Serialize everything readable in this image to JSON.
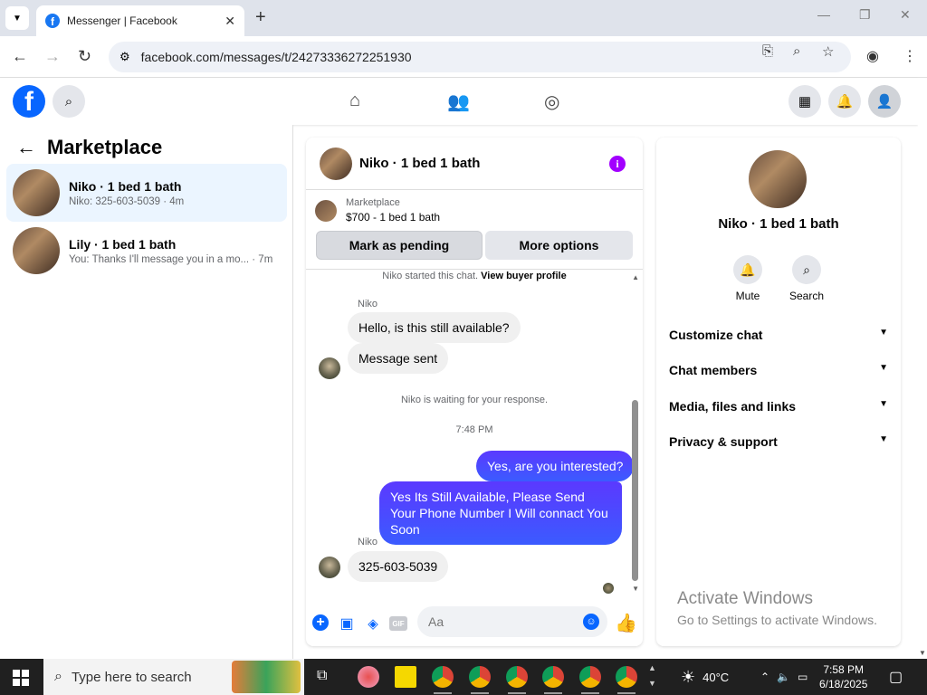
{
  "browser": {
    "tab_title": "Messenger | Facebook",
    "url": "facebook.com/messages/t/24273336272251930"
  },
  "sidebar": {
    "title": "Marketplace",
    "conversations": [
      {
        "name": "Niko · 1 bed 1 bath",
        "snippet": "Niko: 325-603-5039 · 4m",
        "active": true
      },
      {
        "name": "Lily · 1 bed 1 bath",
        "snippet": "You: Thanks I'll message you in a mo... · 7m",
        "active": false
      }
    ]
  },
  "chat": {
    "header_name": "Niko · 1 bed 1 bath",
    "listing_category": "Marketplace",
    "listing_price": "$700 - 1 bed 1 bath",
    "btn_pending": "Mark as pending",
    "btn_more": "More options",
    "started_text": "Niko started this chat.",
    "view_profile": "View buyer profile",
    "sender1": "Niko",
    "msg1": "Hello, is this still available?",
    "msg2": "Message sent",
    "waiting": "Niko is waiting for your response.",
    "time": "7:48 PM",
    "out1": "Yes, are you interested?",
    "out2": "Yes Its Still Available, Please Send Your Phone Number I Will connact You Soon",
    "sender2": "Niko",
    "msg3": "325-603-5039",
    "input_placeholder": "Aa",
    "gif_label": "GIF"
  },
  "details": {
    "name": "Niko · 1 bed 1 bath",
    "mute": "Mute",
    "search": "Search",
    "sections": [
      "Customize chat",
      "Chat members",
      "Media, files and links",
      "Privacy & support"
    ]
  },
  "watermark": {
    "line1": "Activate Windows",
    "line2": "Go to Settings to activate Windows."
  },
  "taskbar": {
    "search_placeholder": "Type here to search",
    "weather": "40°C",
    "time": "7:58 PM",
    "date": "6/18/2025"
  }
}
